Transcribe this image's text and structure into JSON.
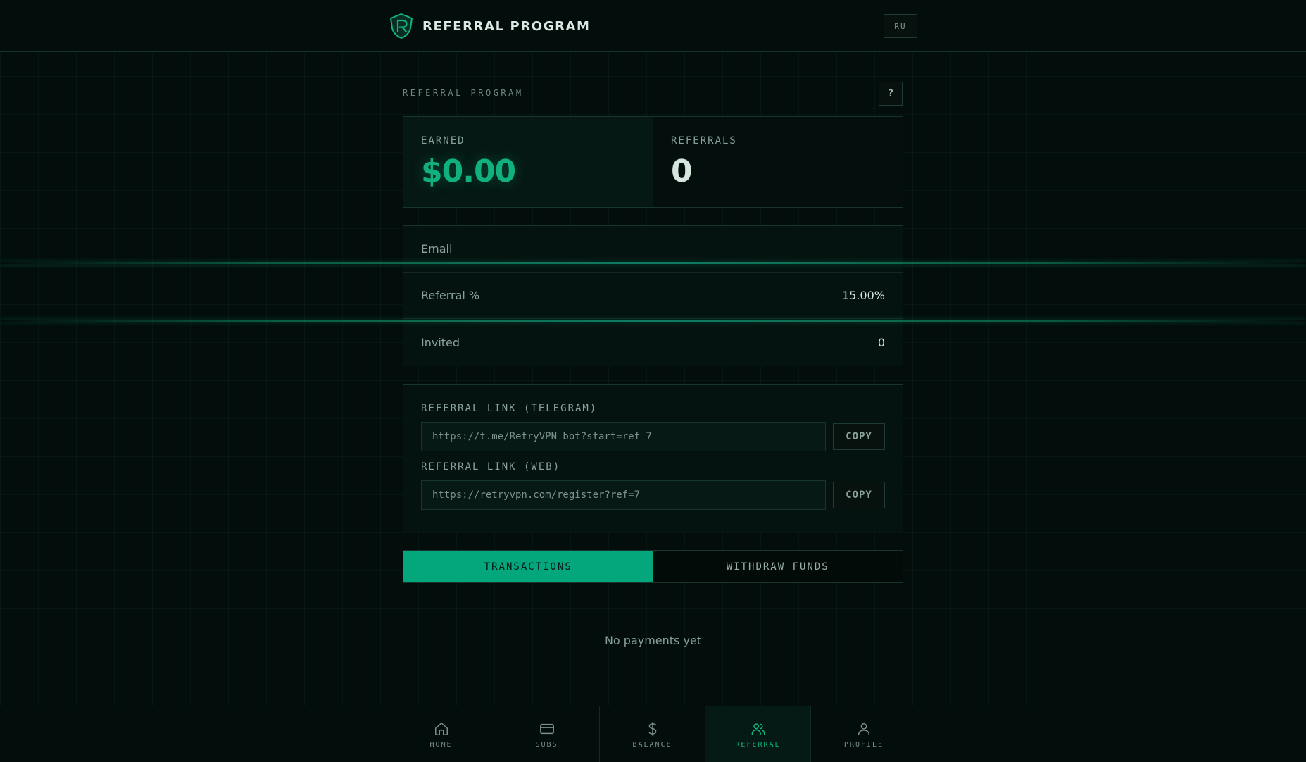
{
  "header": {
    "title": "REFERRAL PROGRAM",
    "lang": "RU"
  },
  "section": {
    "label": "REFERRAL PROGRAM",
    "help": "?"
  },
  "stats": {
    "earned_label": "EARNED",
    "earned_value": "$0.00",
    "referrals_label": "REFERRALS",
    "referrals_value": "0"
  },
  "info": {
    "email_label": "Email",
    "email_value": "",
    "percent_label": "Referral %",
    "percent_value": "15.00%",
    "invited_label": "Invited",
    "invited_value": "0"
  },
  "links": {
    "telegram_label": "REFERRAL LINK (TELEGRAM)",
    "telegram_url": "https://t.me/RetryVPN_bot?start=ref_7",
    "web_label": "REFERRAL LINK (WEB)",
    "web_url": "https://retryvpn.com/register?ref=7",
    "copy_label": "COPY"
  },
  "tabs": {
    "transactions": "TRANSACTIONS",
    "withdraw": "WITHDRAW FUNDS"
  },
  "empty": "No payments yet",
  "nav": {
    "home": "HOME",
    "subs": "SUBS",
    "balance": "BALANCE",
    "referral": "REFERRAL",
    "profile": "PROFILE"
  },
  "colors": {
    "accent": "#10b07f",
    "background": "#030d0b"
  }
}
